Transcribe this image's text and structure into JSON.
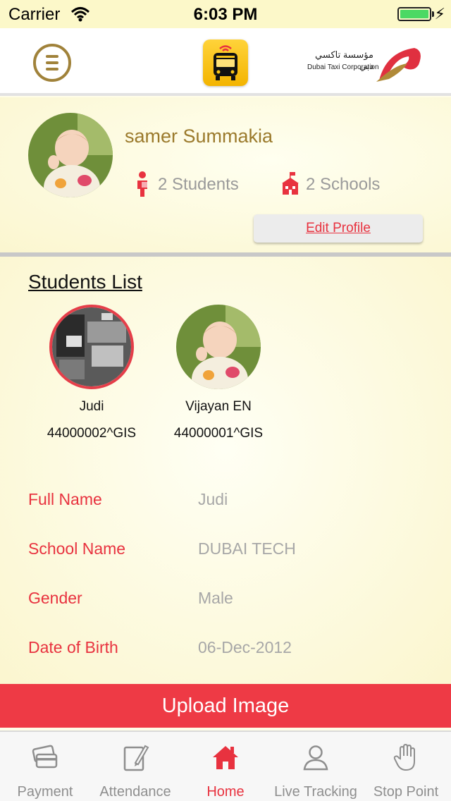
{
  "status_bar": {
    "carrier": "Carrier",
    "time": "6:03 PM"
  },
  "header": {
    "menu_icon": "hamburger-menu-icon",
    "app_logo": "school-bus-icon",
    "brand_arabic": "مؤسسة تاكسي دبي",
    "brand_english": "Dubai Taxi Corporation"
  },
  "profile": {
    "name": "samer Summakia",
    "students_count": "2 Students",
    "schools_count": "2 Schools",
    "edit_label": "Edit Profile"
  },
  "students": {
    "title": "Students List",
    "items": [
      {
        "name": "Judi",
        "id": "44000002^GIS",
        "selected": true
      },
      {
        "name": "Vijayan EN",
        "id": "44000001^GIS",
        "selected": false
      }
    ]
  },
  "details": {
    "full_name_label": "Full Name",
    "full_name": "Judi",
    "school_label": "School Name",
    "school": "DUBAI TECH",
    "gender_label": "Gender",
    "gender": "Male",
    "dob_label": "Date of Birth",
    "dob": "06-Dec-2012"
  },
  "upload_label": "Upload Image",
  "tabs": [
    {
      "label": "Payment",
      "icon": "credit-card-icon"
    },
    {
      "label": "Attendance",
      "icon": "notepad-icon"
    },
    {
      "label": "Home",
      "icon": "home-icon",
      "active": true
    },
    {
      "label": "Live Tracking",
      "icon": "person-icon"
    },
    {
      "label": "Stop Point",
      "icon": "hand-icon"
    }
  ],
  "colors": {
    "accent": "#e8323f",
    "gold": "#9b7a2c",
    "status_bar": "#fcf8c9",
    "battery": "#4cd964"
  }
}
